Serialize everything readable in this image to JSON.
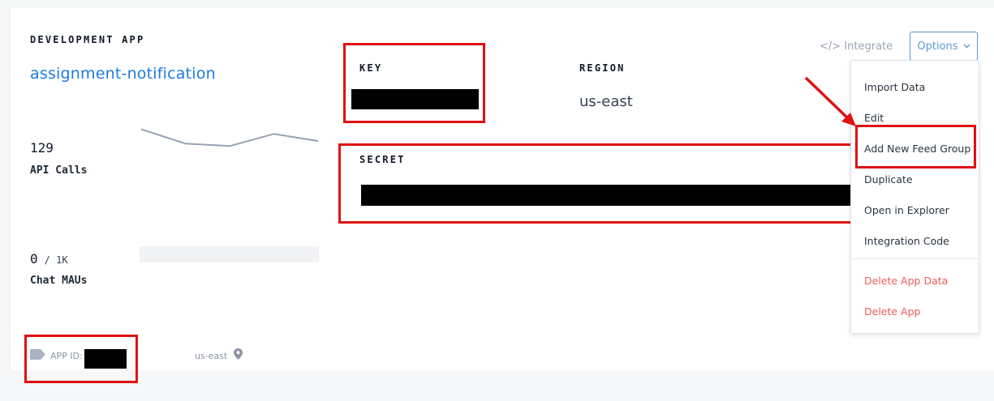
{
  "app": {
    "env_label": "DEVELOPMENT APP",
    "name": "assignment-notification"
  },
  "stats": {
    "api_calls": {
      "value": "129",
      "label": "API Calls",
      "trend": [
        0.85,
        0.45,
        0.38,
        0.72,
        0.52
      ]
    },
    "chat_maus": {
      "value": "0",
      "limit": "/ 1K",
      "label": "Chat MAUs",
      "usage_fraction": 0
    }
  },
  "credentials": {
    "key_label": "KEY",
    "region_label": "REGION",
    "region_value": "us-east",
    "secret_label": "SECRET"
  },
  "toolbar": {
    "integrate_label": "</> Integrate",
    "options_label": "Options"
  },
  "menu": {
    "items": [
      {
        "label": "Import Data"
      },
      {
        "label": "Edit"
      },
      {
        "label": "Add New Feed Group"
      },
      {
        "label": "Duplicate"
      },
      {
        "label": "Open in Explorer"
      },
      {
        "label": "Integration Code"
      },
      {
        "label": "Delete App Data"
      },
      {
        "label": "Delete App"
      }
    ]
  },
  "footer": {
    "app_id_label": "APP ID:",
    "region": "us-east"
  },
  "colors": {
    "accent": "#1f7ae0",
    "highlight": "#e01212",
    "danger": "#ef5a5a",
    "chart_line": "#98a2b3"
  },
  "icons": {
    "tag": "tag-icon",
    "location": "location-pin-icon",
    "chevron": "chevron-down-icon",
    "arrow": "annotation-arrow-icon"
  }
}
